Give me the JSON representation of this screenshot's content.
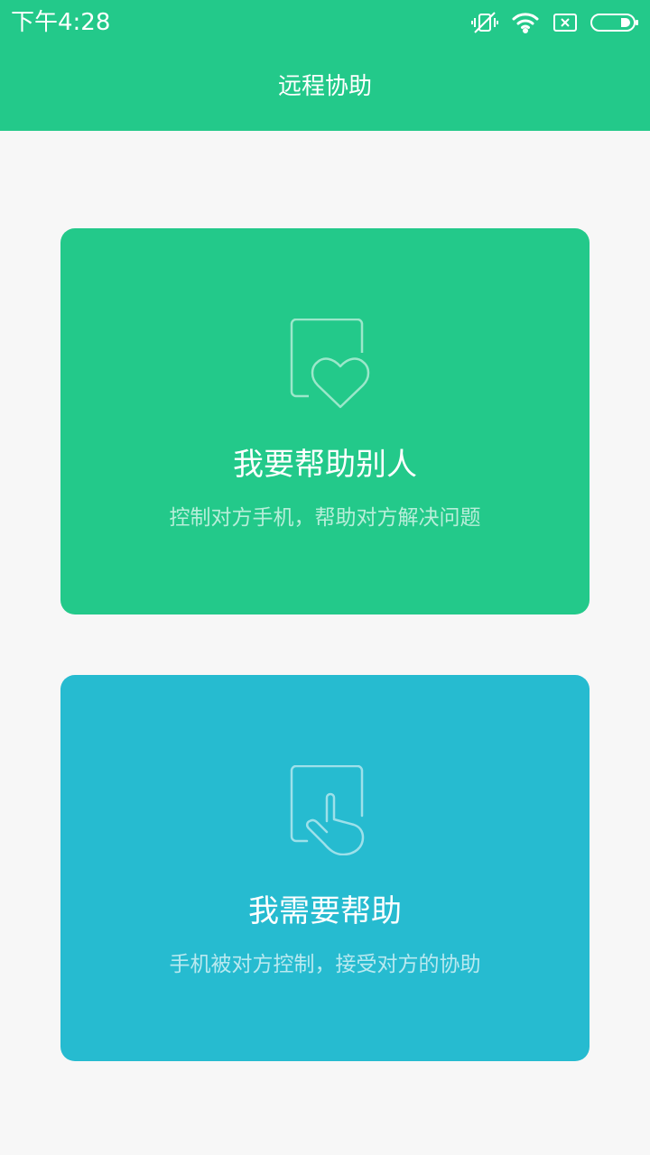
{
  "status_bar": {
    "time": "下午4:28",
    "icons": [
      "vibrate-silent-icon",
      "wifi-icon",
      "sim-error-icon",
      "battery-icon"
    ]
  },
  "header": {
    "title": "远程协助"
  },
  "cards": [
    {
      "title": "我要帮助别人",
      "description": "控制对方手机，帮助对方解决问题",
      "icon": "heart-device-icon",
      "color": "#23c98a"
    },
    {
      "title": "我需要帮助",
      "description": "手机被对方控制，接受对方的协助",
      "icon": "hand-touch-icon",
      "color": "#26bbd0"
    }
  ],
  "colors": {
    "accent": "#23c98a",
    "secondary": "#26bbd0",
    "background": "#f7f7f7"
  }
}
